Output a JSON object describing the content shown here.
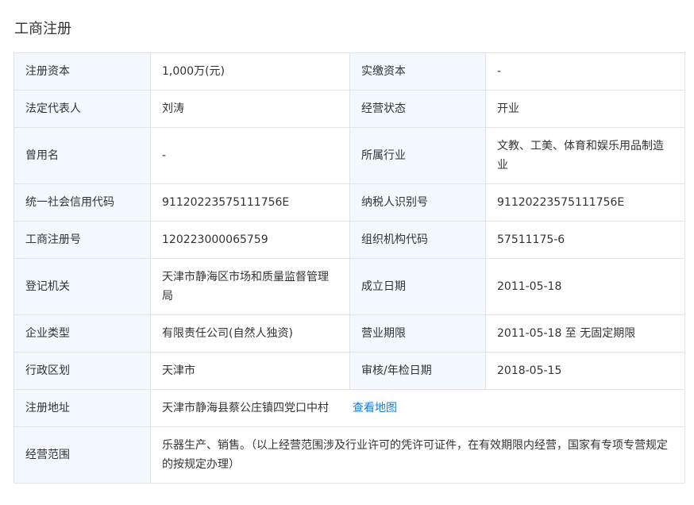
{
  "section_title": "工商注册",
  "fields": {
    "registered_capital": {
      "label": "注册资本",
      "value": "1,000万(元)"
    },
    "paid_capital": {
      "label": "实缴资本",
      "value": "-"
    },
    "legal_rep": {
      "label": "法定代表人",
      "value": "刘涛"
    },
    "status": {
      "label": "经营状态",
      "value": "开业"
    },
    "former_name": {
      "label": "曾用名",
      "value": "-"
    },
    "industry": {
      "label": "所属行业",
      "value": "文教、工美、体育和娱乐用品制造业"
    },
    "credit_code": {
      "label": "统一社会信用代码",
      "value": "91120223575111756E"
    },
    "taxpayer_id": {
      "label": "纳税人识别号",
      "value": "91120223575111756E"
    },
    "reg_number": {
      "label": "工商注册号",
      "value": "120223000065759"
    },
    "org_code": {
      "label": "组织机构代码",
      "value": "57511175-6"
    },
    "reg_authority": {
      "label": "登记机关",
      "value": "天津市静海区市场和质量监督管理局"
    },
    "founded": {
      "label": "成立日期",
      "value": "2011-05-18"
    },
    "company_type": {
      "label": "企业类型",
      "value": "有限责任公司(自然人独资)"
    },
    "business_term": {
      "label": "营业期限",
      "value": "2011-05-18 至 无固定期限"
    },
    "region": {
      "label": "行政区划",
      "value": "天津市"
    },
    "audit_date": {
      "label": "审核/年检日期",
      "value": "2018-05-15"
    },
    "address": {
      "label": "注册地址",
      "value": "天津市静海县蔡公庄镇四党口中村",
      "link": "查看地图"
    },
    "scope": {
      "label": "经营范围",
      "value": "乐器生产、销售。（以上经营范围涉及行业许可的凭许可证件，在有效期限内经营，国家有专项专营规定的按规定办理）"
    }
  }
}
